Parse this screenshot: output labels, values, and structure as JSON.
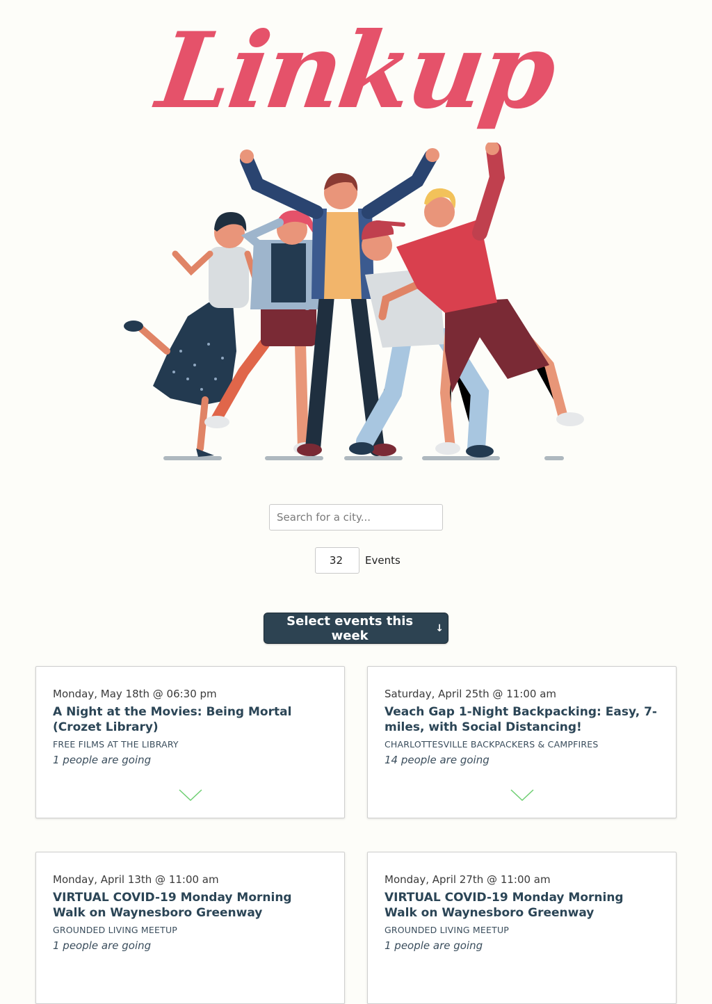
{
  "brand": {
    "logo_text": "Linkup",
    "accent": "#e5526a"
  },
  "search": {
    "placeholder": "Search for a city..."
  },
  "events_count": {
    "value": "32",
    "label": "Events"
  },
  "select_button": {
    "label": "Select events this week",
    "arrow": "↓"
  },
  "colors": {
    "button_bg": "#2d4352",
    "chevron": "#6fcf73",
    "title": "#2b4556"
  },
  "events": [
    {
      "date": "Monday, May 18th @ 06:30 pm",
      "title": "A Night at the Movies: Being Mortal (Crozet Library)",
      "group": "FREE FILMS AT THE LIBRARY",
      "going": "1 people are going"
    },
    {
      "date": "Saturday, April 25th @ 11:00 am",
      "title": "Veach Gap 1-Night Backpacking: Easy, 7-miles, with Social Distancing!",
      "group": "CHARLOTTESVILLE BACKPACKERS & CAMPFIRES",
      "going": "14 people are going"
    },
    {
      "date": "Monday, April 13th @ 11:00 am",
      "title": "VIRTUAL COVID-19 Monday Morning Walk on Waynesboro Greenway",
      "group": "GROUNDED LIVING MEETUP",
      "going": "1 people are going"
    },
    {
      "date": "Monday, April 27th @ 11:00 am",
      "title": "VIRTUAL COVID-19 Monday Morning Walk on Waynesboro Greenway",
      "group": "GROUNDED LIVING MEETUP",
      "going": "1 people are going"
    }
  ]
}
